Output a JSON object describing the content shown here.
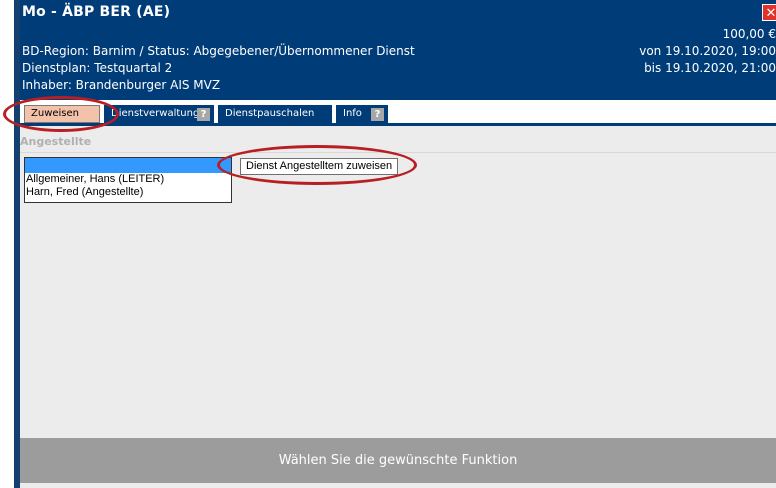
{
  "window": {
    "title": "Mo - ÄBP BER (AE)",
    "close_glyph": "✕",
    "region_status": "BD-Region: Barnim / Status: Abgegebener/Übernommener Dienst",
    "dienstplan": "Dienstplan: Testquartal 2",
    "inhaber": "Inhaber: Brandenburger AIS MVZ",
    "amount": "100,00 €",
    "von": "von 19.10.2020, 19:00",
    "bis": "bis 19.10.2020, 21:00"
  },
  "tabs": [
    {
      "label": "Zuweisen",
      "active": true
    },
    {
      "label": "Dienstverwaltung",
      "help": "?"
    },
    {
      "label": "Dienstpauschalen"
    },
    {
      "label": "Info",
      "help": "?"
    }
  ],
  "section": {
    "label": "Angestellte"
  },
  "listbox": {
    "options": [
      "",
      "Allgemeiner, Hans (LEITER)",
      "Harn, Fred (Angestellte)"
    ],
    "selected_index": 0
  },
  "assign_button": {
    "label": "Dienst Angestelltem zuweisen"
  },
  "footer": {
    "text": "Wählen Sie die gewünschte Funktion"
  },
  "colors": {
    "header_bg": "#003c78",
    "active_tab_bg": "#f3c2aa",
    "footer_bg": "#9c9c9c",
    "annotation_red": "#b81f23",
    "selection_blue": "#3399ff"
  }
}
